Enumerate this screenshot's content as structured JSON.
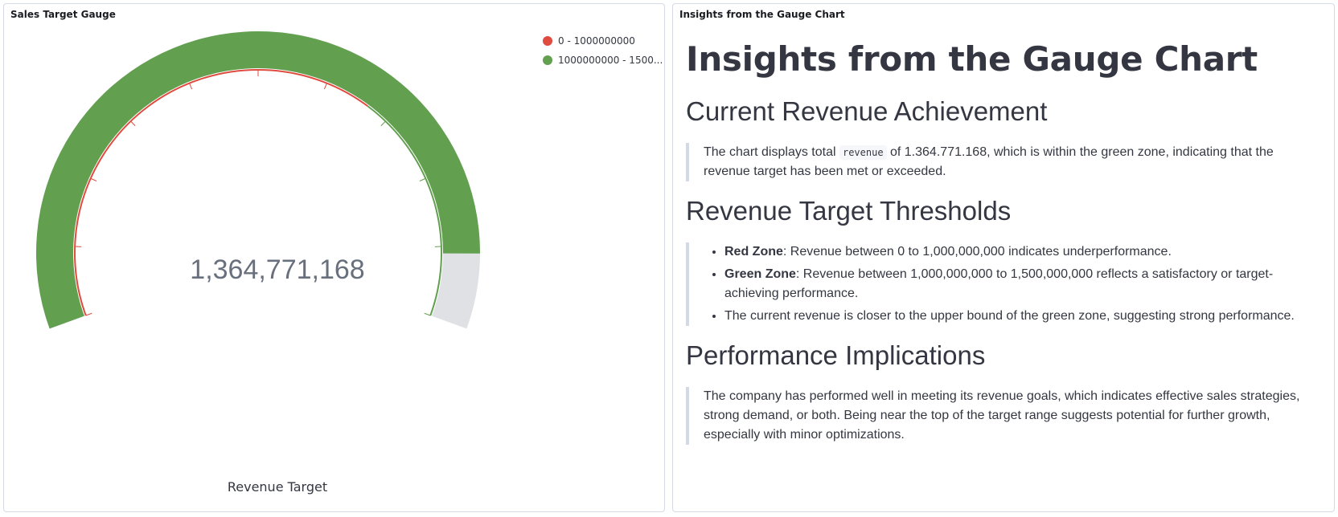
{
  "left_panel": {
    "title": "Sales Target Gauge"
  },
  "right_panel": {
    "title": "Insights from the Gauge Chart",
    "heading": "Insights from the Gauge Chart",
    "sections": [
      {
        "title": "Current Revenue Achievement",
        "text_before": "The chart displays total ",
        "code": "revenue",
        "text_after": " of 1.364.771.168, which is within the green zone, indicating that the revenue target has been met or exceeded."
      },
      {
        "title": "Revenue Target Thresholds",
        "bullets": [
          {
            "bold": "Red Zone",
            "text": ": Revenue between 0 to 1,000,000,000 indicates underperformance."
          },
          {
            "bold": "Green Zone",
            "text": ": Revenue between 1,000,000,000 to 1,500,000,000 reflects a satisfactory or target-achieving performance."
          },
          {
            "bold": "",
            "text": "The current revenue is closer to the upper bound of the green zone, suggesting strong performance."
          }
        ]
      },
      {
        "title": "Performance Implications",
        "text": "The company has performed well in meeting its revenue goals, which indicates effective sales strategies, strong demand, or both. Being near the top of the target range suggests potential for further growth, especially with minor optimizations."
      }
    ]
  },
  "chart_data": {
    "type": "gauge",
    "value": 1364771168,
    "value_label": "1,364,771,168",
    "label": "Revenue Target",
    "min": 0,
    "max": 1500000000,
    "ranges": [
      {
        "from": 0,
        "to": 1000000000,
        "color": "#e7664c",
        "legend": "0 - 1000000000"
      },
      {
        "from": 1000000000,
        "to": 1500000000,
        "color": "#54b399",
        "legend": "1000000000 - 1500..."
      }
    ],
    "fill_color": "#629f4f",
    "track_color": "#e0e1e5",
    "band_colors": [
      "#e04b3f",
      "#629f4f"
    ],
    "legend_colors": [
      "#e04b3f",
      "#629f4f"
    ],
    "legend_position": "top-right"
  }
}
